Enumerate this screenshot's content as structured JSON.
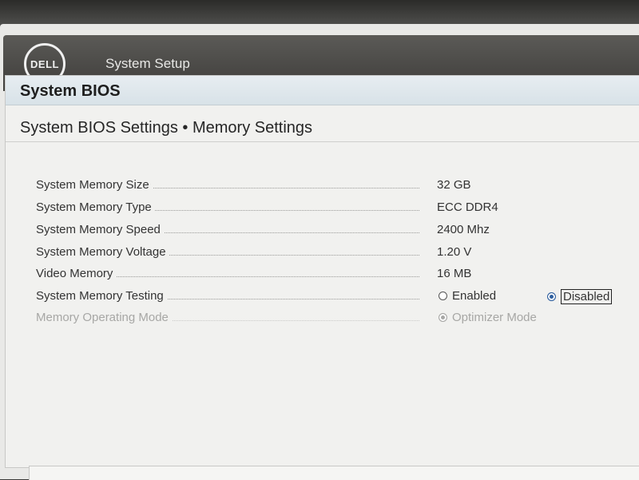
{
  "header": {
    "logo_text": "DELL",
    "app_title": "System Setup"
  },
  "panel": {
    "title": "System BIOS",
    "breadcrumb": "System BIOS Settings • Memory Settings"
  },
  "settings": [
    {
      "label": "System Memory Size",
      "value": "32 GB"
    },
    {
      "label": "System Memory Type",
      "value": "ECC DDR4"
    },
    {
      "label": "System Memory Speed",
      "value": "2400 Mhz"
    },
    {
      "label": "System Memory Voltage",
      "value": "1.20 V"
    },
    {
      "label": "Video Memory",
      "value": "16 MB"
    }
  ],
  "memory_testing": {
    "label": "System Memory Testing",
    "options": [
      "Enabled",
      "Disabled"
    ],
    "selected": "Disabled"
  },
  "operating_mode": {
    "label": "Memory Operating Mode",
    "value": "Optimizer Mode",
    "enabled": false
  },
  "colors": {
    "header_bg": "#4a4946",
    "panel_head_bg": "#dde6eb",
    "radio_selected": "#2d5e9e"
  }
}
